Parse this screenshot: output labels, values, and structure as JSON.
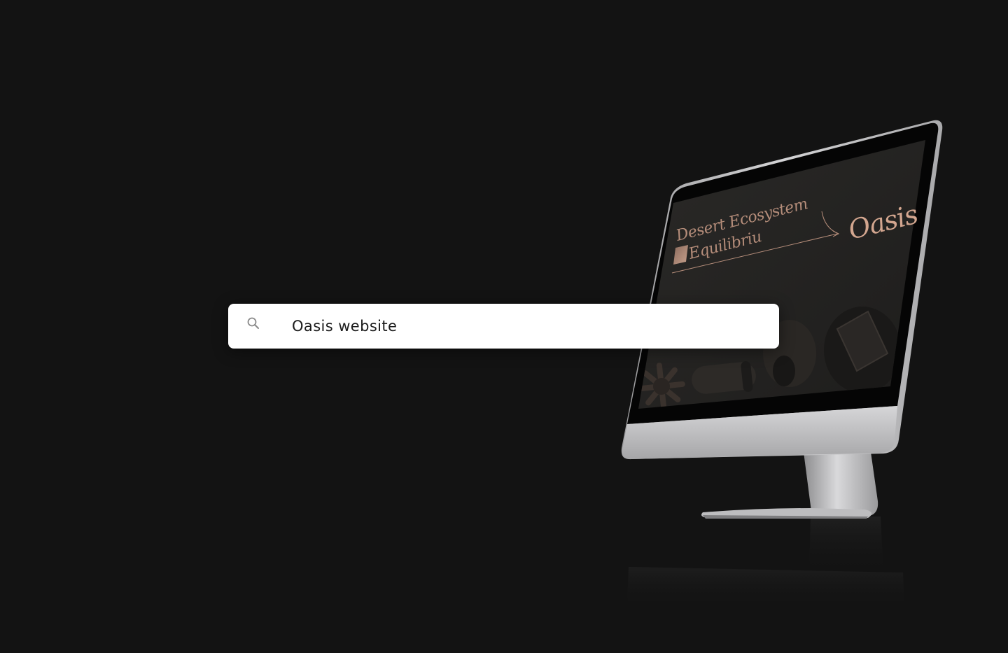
{
  "search": {
    "value": "Oasis website",
    "icon": "search-icon"
  },
  "monitor_screen": {
    "headline_line1": "Desert Ecosystem",
    "headline_line2": "Equilibriu",
    "logo": "Oasis"
  },
  "colors": {
    "background": "#131313",
    "search_bg": "#ffffff",
    "accent_copper": "#d3a68f"
  }
}
